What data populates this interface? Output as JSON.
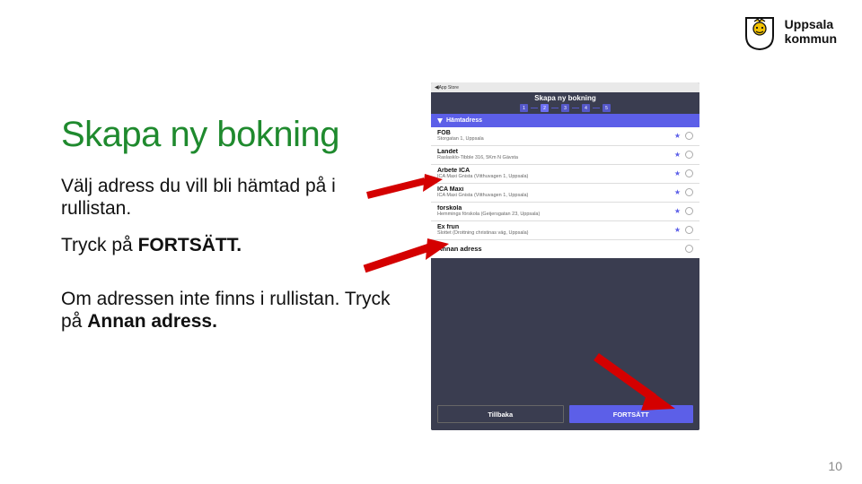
{
  "logo": {
    "line1": "Uppsala",
    "line2": "kommun"
  },
  "title": "Skapa ny bokning",
  "paragraphs": {
    "p1": "Välj adress du vill bli hämtad på i rullistan.",
    "p2a": "Tryck på ",
    "p2b": "FORTSÄTT.",
    "p3a": "Om adressen inte finns i rullistan. Tryck på ",
    "p3b": "Annan adress."
  },
  "mock": {
    "statusbar": "App Store",
    "header_title": "Skapa ny bokning",
    "steps": [
      "1",
      "2",
      "3",
      "4",
      "5"
    ],
    "section_label": "Hämtadress",
    "addresses": [
      {
        "name": "FOB",
        "detail": "Storgatan 1, Uppsala"
      },
      {
        "name": "Landet",
        "detail": "Raslasklo-Tibble 316, 5Km N Gävsta"
      },
      {
        "name": "Arbete ICA",
        "detail": "ICA Maxi Gnista (Vitthuvagen 1, Uppsala)"
      },
      {
        "name": "ICA Maxi",
        "detail": "ICA Maxi Gnista (Vitthuvagen 1, Uppsala)"
      },
      {
        "name": "forskola",
        "detail": "Hemmings förskola (Geijersgatan 23, Uppsala)"
      },
      {
        "name": "Ex frun",
        "detail": "Slottet (Drottning christinas väg, Uppsala)"
      }
    ],
    "annan_label": "Annan adress",
    "back_label": "Tillbaka",
    "next_label": "FORTSÄTT"
  },
  "page_number": "10"
}
